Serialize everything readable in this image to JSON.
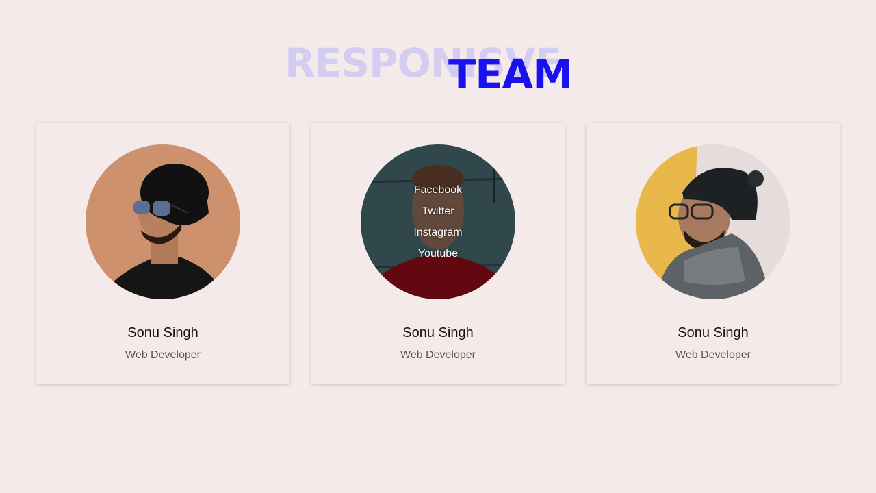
{
  "header": {
    "title_back": "RESPONISVE",
    "title_front": "TEAM"
  },
  "colors": {
    "background": "#f5eaea",
    "accent": "#1a12ee",
    "accent_faded": "#d3cdf2"
  },
  "team": [
    {
      "name": "Sonu Singh",
      "role": "Web Developer"
    },
    {
      "name": "Sonu Singh",
      "role": "Web Developer",
      "social": [
        "Facebook",
        "Twitter",
        "Instagram",
        "Youtube"
      ]
    },
    {
      "name": "Sonu Singh",
      "role": "Web Developer"
    }
  ]
}
